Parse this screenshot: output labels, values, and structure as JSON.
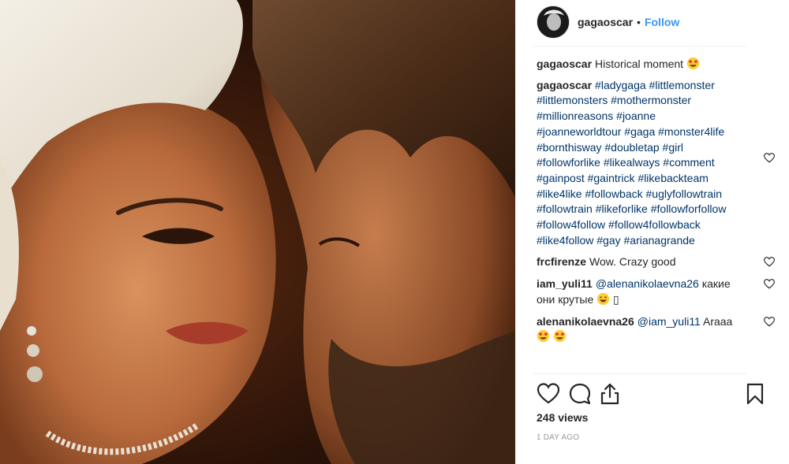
{
  "post": {
    "username": "gagaoscar",
    "separator": "•",
    "follow_label": "Follow"
  },
  "caption": {
    "user": "gagaoscar",
    "text": "Historical moment"
  },
  "comments": [
    {
      "user": "gagaoscar",
      "text": "#ladygaga #littlemonster #littlemonsters #mothermonster #millionreasons #joanne #joanneworldtour #gaga #monster4life #bornthisway #doubletap #girl #followforlike #likealways #comment #gainpost #gaintrick #likebackteam #like4like #followback #uglyfollowtrain #followtrain #likeforlike #followforfollow #follow4follow #follow4followback #like4follow #gay #arianagrande"
    },
    {
      "user": "frcfirenze",
      "text": "Wow. Crazy good"
    },
    {
      "user": "iam_yuli11",
      "mention": "@alenanikolaevna26",
      "text": "какие они крутые",
      "tail": "▯"
    },
    {
      "user": "alenanikolaevna26",
      "mention": "@iam_yuli11",
      "text": "Araaa"
    }
  ],
  "icons": {
    "like": "heart-outline-icon",
    "comment": "speech-bubble-icon",
    "share": "share-upload-icon",
    "save": "bookmark-icon"
  },
  "stats": {
    "views": "248 views",
    "time": "1 DAY AGO"
  },
  "colors": {
    "link": "#3897f0",
    "hashtag": "#003569",
    "text": "#262626",
    "muted": "#999999",
    "divider": "#efefef"
  }
}
